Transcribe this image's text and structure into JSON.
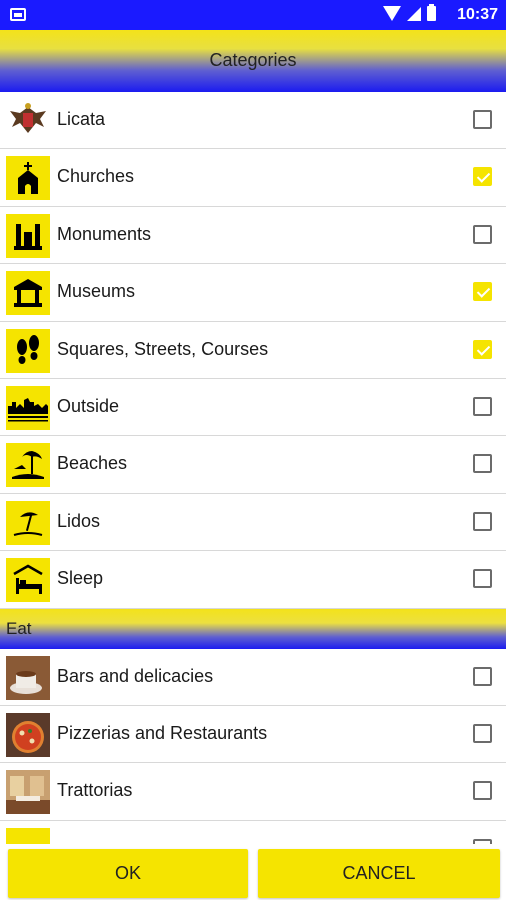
{
  "status_bar": {
    "time": "10:37"
  },
  "header": {
    "title": "Categories"
  },
  "categories": [
    {
      "label": "Licata",
      "icon": "crest-icon",
      "checked": false
    },
    {
      "label": "Churches",
      "icon": "church-icon",
      "checked": true
    },
    {
      "label": "Monuments",
      "icon": "monument-icon",
      "checked": false
    },
    {
      "label": "Museums",
      "icon": "museum-icon",
      "checked": true
    },
    {
      "label": "Squares, Streets, Courses",
      "icon": "footprints-icon",
      "checked": true
    },
    {
      "label": "Outside",
      "icon": "skyline-icon",
      "checked": false
    },
    {
      "label": "Beaches",
      "icon": "palm-beach-icon",
      "checked": false
    },
    {
      "label": "Lidos",
      "icon": "umbrella-icon",
      "checked": false
    },
    {
      "label": "Sleep",
      "icon": "bed-icon",
      "checked": false
    }
  ],
  "eat_section": {
    "title": "Eat",
    "items": [
      {
        "label": "Bars and delicacies",
        "icon": "coffee-photo",
        "checked": false
      },
      {
        "label": "Pizzerias and Restaurants",
        "icon": "pizza-photo",
        "checked": false
      },
      {
        "label": "Trattorias",
        "icon": "trattoria-photo",
        "checked": false
      },
      {
        "label": "",
        "icon": "partial-icon",
        "checked": false
      }
    ]
  },
  "footer": {
    "ok_label": "OK",
    "cancel_label": "CANCEL"
  },
  "colors": {
    "yellow": "#f5e400",
    "blue": "#1b1bf0"
  }
}
